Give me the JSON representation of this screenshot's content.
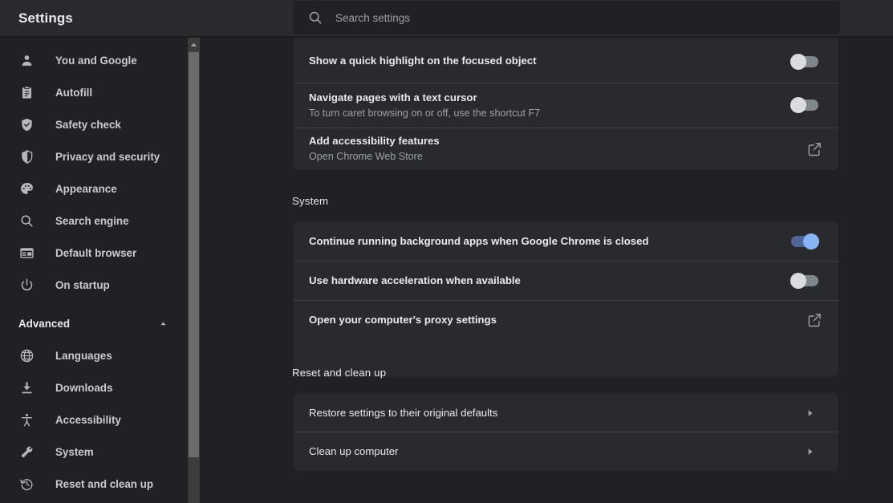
{
  "header": {
    "title": "Settings",
    "search_placeholder": "Search settings",
    "search_value": ""
  },
  "sidebar": {
    "items": [
      {
        "label": "You and Google",
        "icon": "person-icon"
      },
      {
        "label": "Autofill",
        "icon": "clipboard-icon"
      },
      {
        "label": "Safety check",
        "icon": "shield-check-icon"
      },
      {
        "label": "Privacy and security",
        "icon": "shield-icon"
      },
      {
        "label": "Appearance",
        "icon": "palette-icon"
      },
      {
        "label": "Search engine",
        "icon": "search-icon"
      },
      {
        "label": "Default browser",
        "icon": "browser-window-icon"
      },
      {
        "label": "On startup",
        "icon": "power-icon"
      }
    ],
    "advanced": {
      "label": "Advanced",
      "expanded": true,
      "items": [
        {
          "label": "Languages",
          "icon": "globe-icon"
        },
        {
          "label": "Downloads",
          "icon": "download-icon"
        },
        {
          "label": "Accessibility",
          "icon": "accessibility-icon"
        },
        {
          "label": "System",
          "icon": "wrench-icon"
        },
        {
          "label": "Reset and clean up",
          "icon": "history-restore-icon"
        }
      ]
    }
  },
  "content": {
    "accessibility_card": {
      "rows": [
        {
          "title": "Show a quick highlight on the focused object",
          "sub": "",
          "control": "toggle",
          "state": "off"
        },
        {
          "title": "Navigate pages with a text cursor",
          "sub": "To turn caret browsing on or off, use the shortcut F7",
          "control": "toggle",
          "state": "off"
        },
        {
          "title": "Add accessibility features",
          "sub": "Open Chrome Web Store",
          "control": "external-link"
        }
      ]
    },
    "system_section": {
      "title": "System",
      "rows": [
        {
          "title": "Continue running background apps when Google Chrome is closed",
          "control": "toggle",
          "state": "on"
        },
        {
          "title": "Use hardware acceleration when available",
          "control": "toggle",
          "state": "off"
        },
        {
          "title": "Open your computer's proxy settings",
          "control": "external-link"
        }
      ]
    },
    "reset_section": {
      "title": "Reset and clean up",
      "rows": [
        {
          "title": "Restore settings to their original defaults",
          "control": "arrow"
        },
        {
          "title": "Clean up computer",
          "control": "arrow"
        }
      ]
    }
  },
  "colors": {
    "page_bg": "#202124",
    "card_bg": "#292a2d",
    "header_bg": "#292a2d",
    "toggle_on_knob": "#8ab4f8",
    "toggle_on_track": "#4e6596",
    "toggle_off_knob": "#dadce0",
    "toggle_off_track": "#80868b",
    "text_primary": "#e8eaed",
    "text_secondary": "#9aa0a6"
  }
}
